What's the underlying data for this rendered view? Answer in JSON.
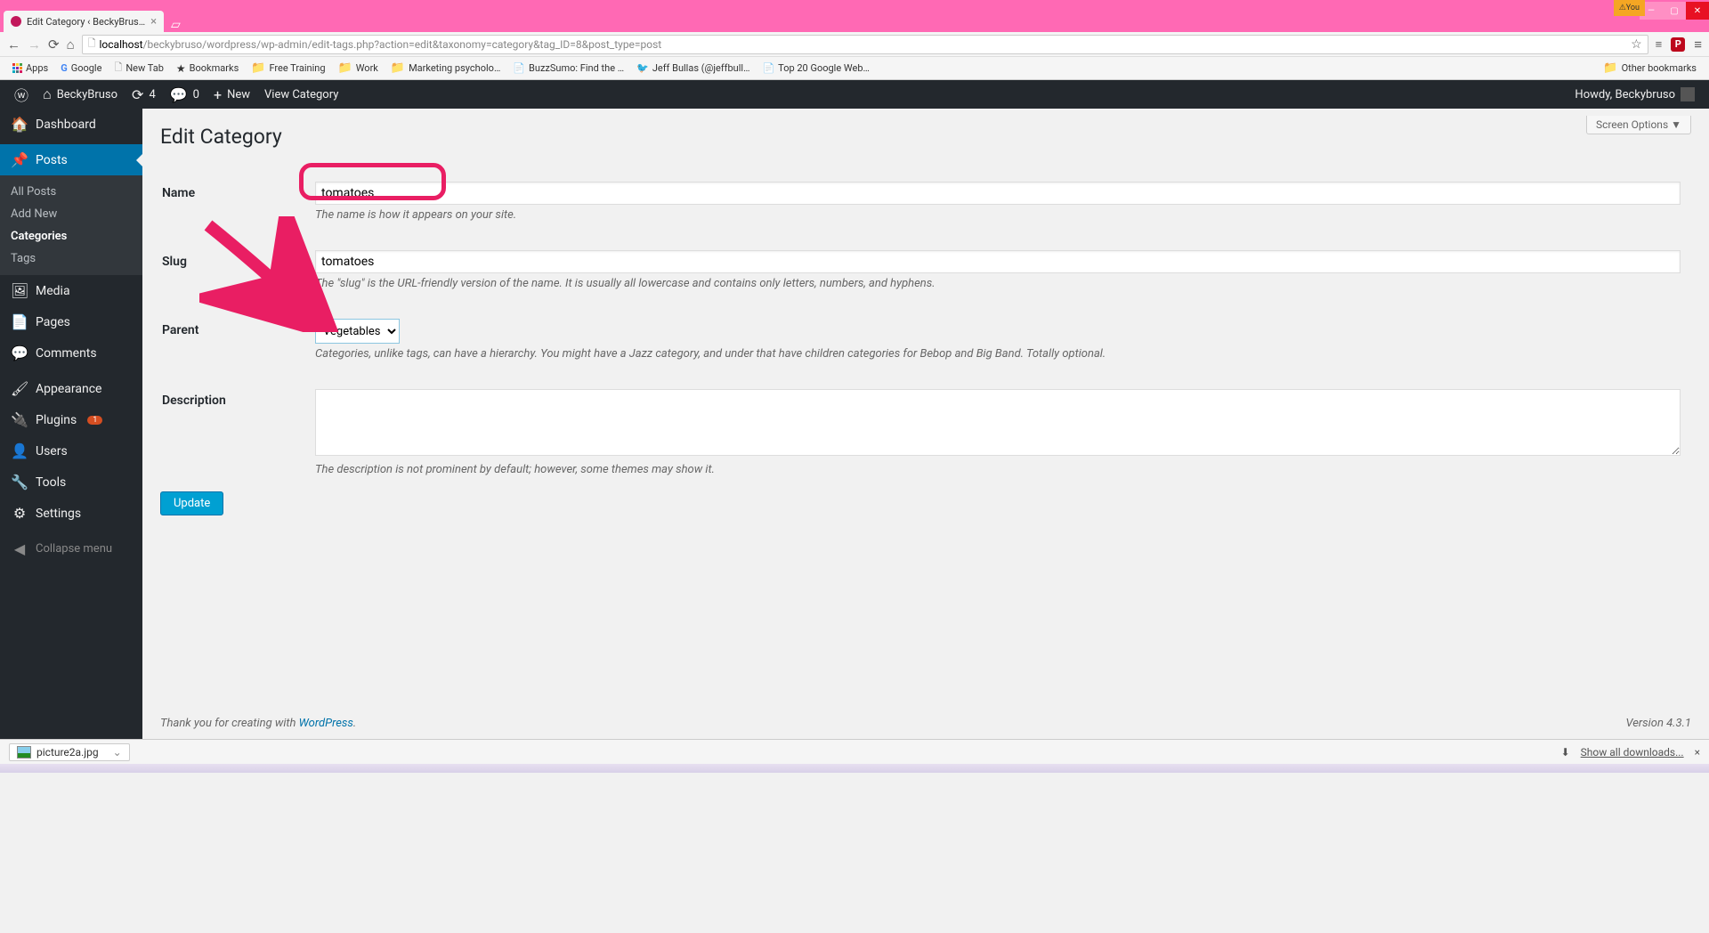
{
  "browser": {
    "tab_title": "Edit Category ‹ BeckyBrus…",
    "url_host": "localhost",
    "url_path": "/beckybruso/wordpress/wp-admin/edit-tags.php?action=edit&taxonomy=category&tag_ID=8&post_type=post",
    "you_label": "You",
    "bookmarks": {
      "apps": "Apps",
      "google": "Google",
      "newtab": "New Tab",
      "bookmarks": "Bookmarks",
      "freetraining": "Free Training",
      "work": "Work",
      "marketing": "Marketing psycholo…",
      "buzzsumo": "BuzzSumo: Find the …",
      "jeffbullas": "Jeff Bullas (@jeffbull…",
      "top20": "Top 20 Google Web…",
      "other": "Other bookmarks"
    }
  },
  "adminbar": {
    "site": "BeckyBruso",
    "updates": "4",
    "comments": "0",
    "new": "New",
    "view": "View Category",
    "howdy": "Howdy, Beckybruso"
  },
  "menu": {
    "dashboard": "Dashboard",
    "posts": "Posts",
    "posts_sub": {
      "all": "All Posts",
      "add": "Add New",
      "categories": "Categories",
      "tags": "Tags"
    },
    "media": "Media",
    "pages": "Pages",
    "comments": "Comments",
    "appearance": "Appearance",
    "plugins": "Plugins",
    "plugins_count": "1",
    "users": "Users",
    "tools": "Tools",
    "settings": "Settings",
    "collapse": "Collapse menu"
  },
  "page": {
    "screen_options": "Screen Options",
    "title": "Edit Category",
    "name_label": "Name",
    "name_value": "tomatoes",
    "name_help": "The name is how it appears on your site.",
    "slug_label": "Slug",
    "slug_value": "tomatoes",
    "slug_help": "The \"slug\" is the URL-friendly version of the name. It is usually all lowercase and contains only letters, numbers, and hyphens.",
    "parent_label": "Parent",
    "parent_value": "Vegetables",
    "parent_help": "Categories, unlike tags, can have a hierarchy. You might have a Jazz category, and under that have children categories for Bebop and Big Band. Totally optional.",
    "desc_label": "Description",
    "desc_value": "",
    "desc_help": "The description is not prominent by default; however, some themes may show it.",
    "update": "Update"
  },
  "footer": {
    "thanks": "Thank you for creating with ",
    "wp": "WordPress",
    "version": "Version 4.3.1"
  },
  "downloads": {
    "file": "picture2a.jpg",
    "showall": "Show all downloads..."
  }
}
